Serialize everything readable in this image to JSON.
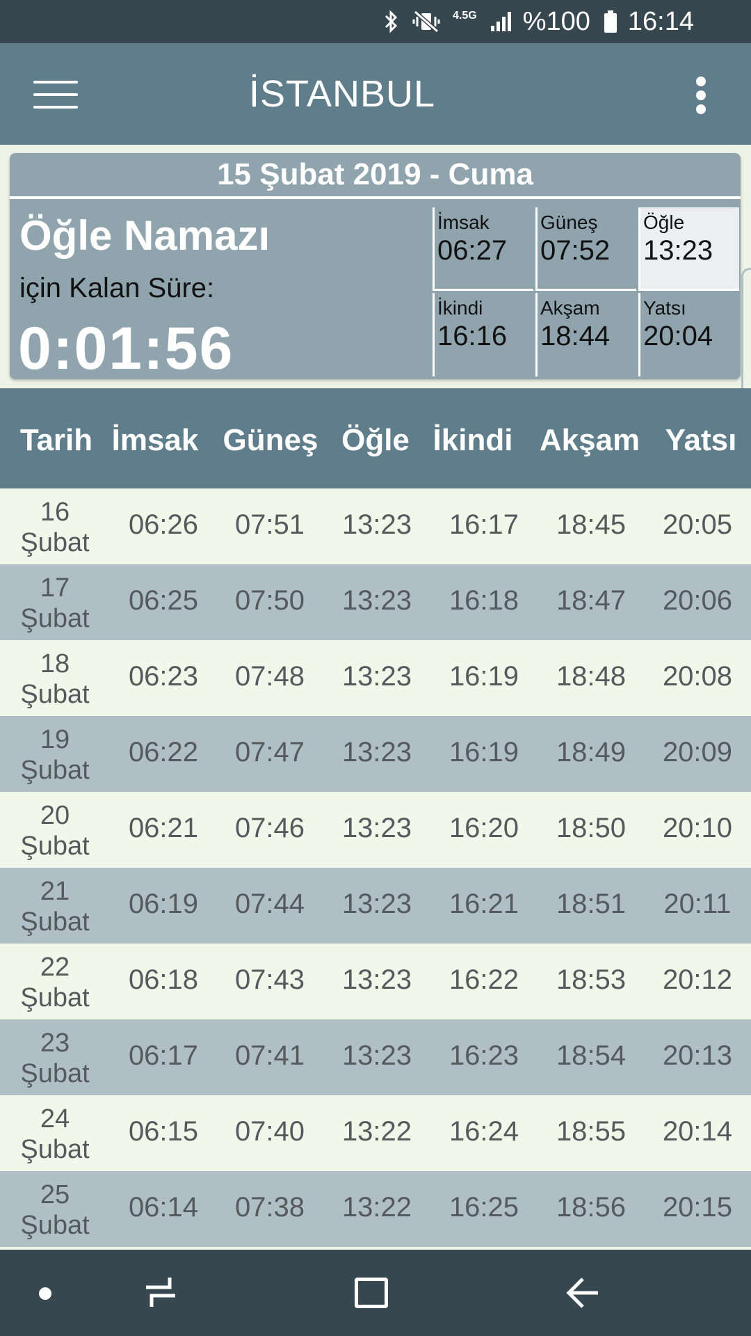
{
  "status_bar": {
    "network": "4.5G",
    "battery_percent": "%100",
    "time": "16:14",
    "icons": [
      "bluetooth-icon",
      "vibrate-mute-icon",
      "signal-icon",
      "battery-icon"
    ]
  },
  "app_bar": {
    "title": "İSTANBUL",
    "icons": [
      "menu-icon",
      "more-vert-icon"
    ]
  },
  "today_card": {
    "date": "15 Şubat 2019 - Cuma",
    "next_prayer": "Öğle Namazı",
    "remaining_label": "için Kalan Süre:",
    "countdown": "0:01:56",
    "active_prayer": "Öğle",
    "times": [
      {
        "label": "İmsak",
        "time": "06:27"
      },
      {
        "label": "Güneş",
        "time": "07:52"
      },
      {
        "label": "Öğle",
        "time": "13:23"
      },
      {
        "label": "İkindi",
        "time": "16:16"
      },
      {
        "label": "Akşam",
        "time": "18:44"
      },
      {
        "label": "Yatsı",
        "time": "20:04"
      }
    ]
  },
  "table": {
    "headers": [
      "Tarih",
      "İmsak",
      "Güneş",
      "Öğle",
      "İkindi",
      "Akşam",
      "Yatsı"
    ],
    "rows": [
      {
        "day": "16",
        "month": "Şubat",
        "times": [
          "06:26",
          "07:51",
          "13:23",
          "16:17",
          "18:45",
          "20:05"
        ]
      },
      {
        "day": "17",
        "month": "Şubat",
        "times": [
          "06:25",
          "07:50",
          "13:23",
          "16:18",
          "18:47",
          "20:06"
        ]
      },
      {
        "day": "18",
        "month": "Şubat",
        "times": [
          "06:23",
          "07:48",
          "13:23",
          "16:19",
          "18:48",
          "20:08"
        ]
      },
      {
        "day": "19",
        "month": "Şubat",
        "times": [
          "06:22",
          "07:47",
          "13:23",
          "16:19",
          "18:49",
          "20:09"
        ]
      },
      {
        "day": "20",
        "month": "Şubat",
        "times": [
          "06:21",
          "07:46",
          "13:23",
          "16:20",
          "18:50",
          "20:10"
        ]
      },
      {
        "day": "21",
        "month": "Şubat",
        "times": [
          "06:19",
          "07:44",
          "13:23",
          "16:21",
          "18:51",
          "20:11"
        ]
      },
      {
        "day": "22",
        "month": "Şubat",
        "times": [
          "06:18",
          "07:43",
          "13:23",
          "16:22",
          "18:53",
          "20:12"
        ]
      },
      {
        "day": "23",
        "month": "Şubat",
        "times": [
          "06:17",
          "07:41",
          "13:23",
          "16:23",
          "18:54",
          "20:13"
        ]
      },
      {
        "day": "24",
        "month": "Şubat",
        "times": [
          "06:15",
          "07:40",
          "13:22",
          "16:24",
          "18:55",
          "20:14"
        ]
      },
      {
        "day": "25",
        "month": "Şubat",
        "times": [
          "06:14",
          "07:38",
          "13:22",
          "16:25",
          "18:56",
          "20:15"
        ]
      }
    ]
  },
  "nav_bar": {
    "icons": [
      "nav-dot-icon",
      "recent-apps-icon",
      "home-icon",
      "back-icon"
    ]
  },
  "colors": {
    "status_bar": "#37474f",
    "app_bar": "#607d8b",
    "card": "#90a4ae",
    "row_light": "#f1f7e9",
    "row_dark": "#b0bec5",
    "active_cell": "#eceff1"
  }
}
